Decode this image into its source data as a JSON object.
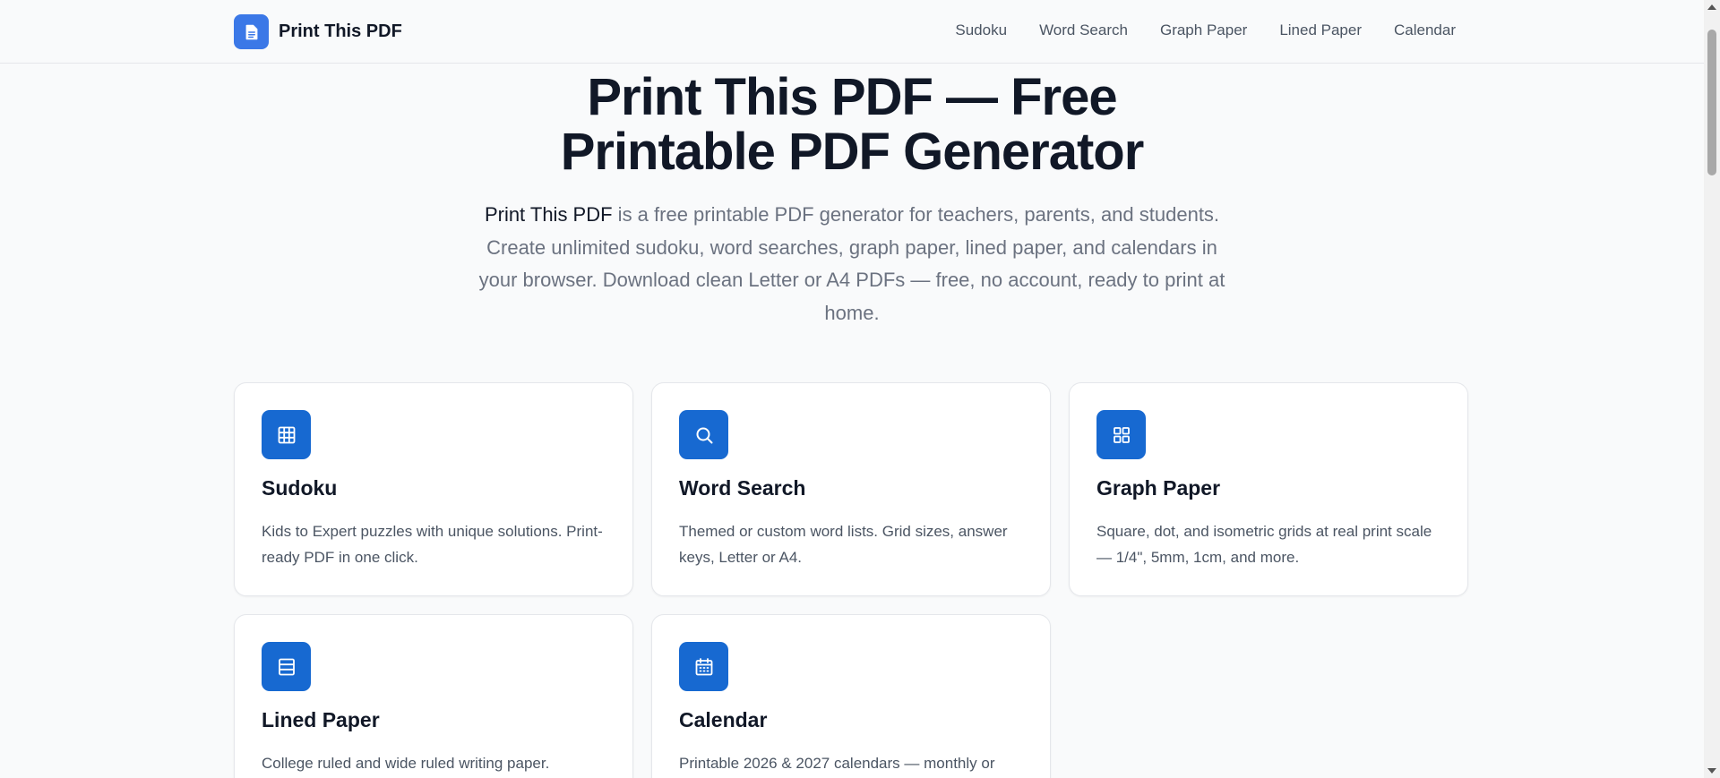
{
  "header": {
    "brand": "Print This PDF",
    "brand_icon": "document-icon",
    "nav": [
      "Sudoku",
      "Word Search",
      "Graph Paper",
      "Lined Paper",
      "Calendar"
    ]
  },
  "hero": {
    "title_line1": "Print This PDF — Free",
    "title_line2": "Printable PDF Generator",
    "subtitle_brand": "Print This PDF",
    "subtitle_rest": " is a free printable PDF generator for teachers, parents, and students. Create unlimited sudoku, word searches, graph paper, lined paper, and calendars in your browser. Download clean Letter or A4 PDFs — free, no account, ready to print at home."
  },
  "cards": [
    {
      "title": "Sudoku",
      "icon": "grid-icon",
      "desc": "Kids to Expert puzzles with unique solutions. Print-ready PDF in one click."
    },
    {
      "title": "Word Search",
      "icon": "search-icon",
      "desc": "Themed or custom word lists. Grid sizes, answer keys, Letter or A4."
    },
    {
      "title": "Graph Paper",
      "icon": "four-squares-icon",
      "desc": "Square, dot, and isometric grids at real print scale — 1/4\", 5mm, 1cm, and more."
    },
    {
      "title": "Lined Paper",
      "icon": "lines-icon",
      "desc": "College ruled and wide ruled writing paper."
    },
    {
      "title": "Calendar",
      "icon": "calendar-icon",
      "desc": "Printable 2026 & 2027 calendars — monthly or"
    }
  ],
  "colors": {
    "accent": "#1769d1",
    "logo": "#3b78e7",
    "background": "#f9fafb",
    "text": "#111827",
    "muted": "#6b7280"
  }
}
